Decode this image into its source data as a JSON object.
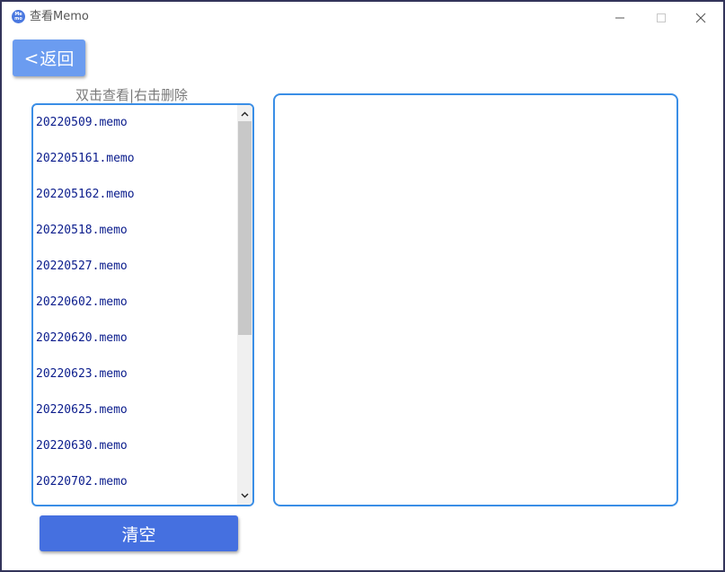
{
  "window": {
    "title": "查看Memo",
    "app_icon_text": "Me mo",
    "accent_color": "#3a8ee6",
    "controls": {
      "minimize_icon": "minimize-icon",
      "maximize_icon": "maximize-icon",
      "close_icon": "close-icon"
    }
  },
  "toolbar": {
    "back_label": "返回",
    "back_chevron": "<"
  },
  "hint": "双击查看|右击删除",
  "memo_list": {
    "items": [
      "20220509.memo",
      "202205161.memo",
      "202205162.memo",
      "20220518.memo",
      "20220527.memo",
      "20220602.memo",
      "20220620.memo",
      "20220623.memo",
      "20220625.memo",
      "20220630.memo",
      "20220702.memo"
    ]
  },
  "content": {
    "text": ""
  },
  "actions": {
    "clear_label": "清空"
  }
}
